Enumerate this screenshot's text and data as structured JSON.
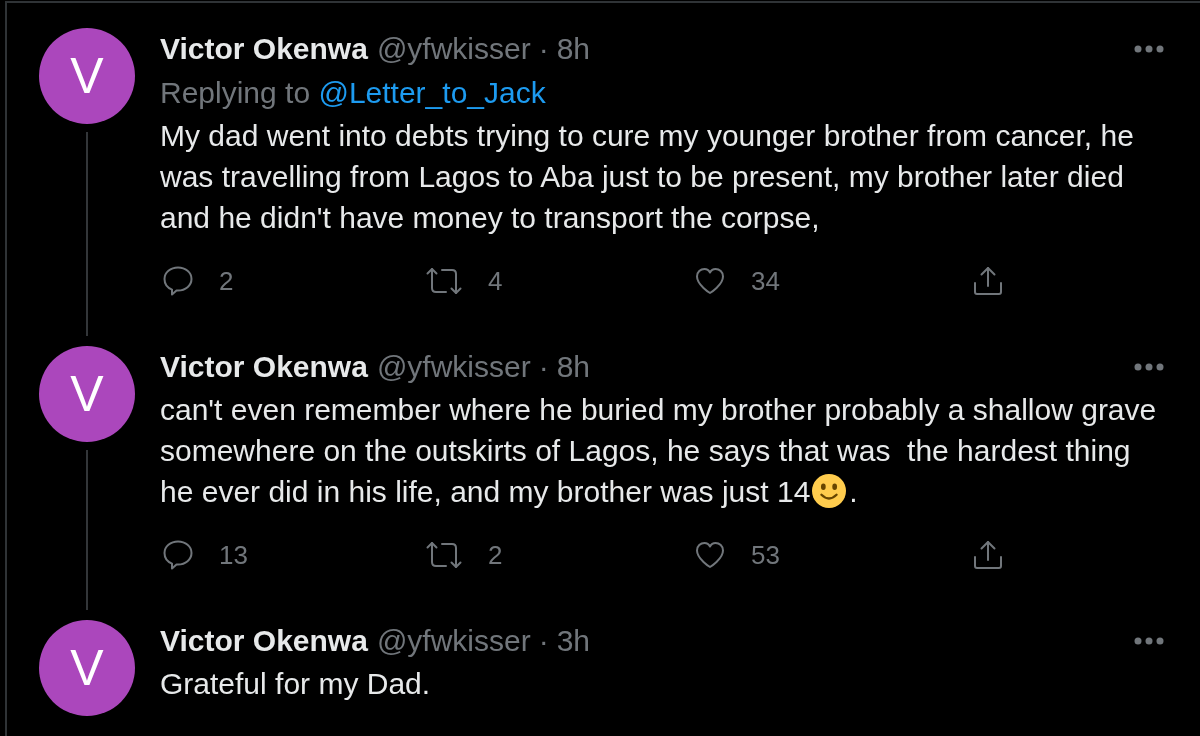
{
  "tweets": [
    {
      "avatar_letter": "V",
      "name": "Victor Okenwa",
      "handle": "@yfwkisser",
      "dot": "·",
      "time": "8h",
      "replying_to": {
        "label": "Replying to",
        "mention": "@Letter_to_Jack"
      },
      "body": [
        {
          "kind": "text",
          "text": "My dad went into debts trying to cure my younger brother from cancer, he was travelling from Lagos to Aba just to be present, my brother later died and he didn't have money to transport the corpse,"
        }
      ],
      "actions": [
        {
          "kind": "reply",
          "count": "2"
        },
        {
          "kind": "retweet",
          "count": "4"
        },
        {
          "kind": "like",
          "count": "34"
        },
        {
          "kind": "share"
        }
      ]
    },
    {
      "avatar_letter": "V",
      "name": "Victor Okenwa",
      "handle": "@yfwkisser",
      "dot": "·",
      "time": "8h",
      "body": [
        {
          "kind": "text",
          "text": "can't even remember where he buried my brother probably a shallow grave somewhere on the outskirts of Lagos, he says that was  the hardest thing he ever did in his life, and my brother was just 14"
        },
        {
          "kind": "emoji"
        },
        {
          "kind": "text",
          "text": "."
        }
      ],
      "actions": [
        {
          "kind": "reply",
          "count": "13"
        },
        {
          "kind": "retweet",
          "count": "2"
        },
        {
          "kind": "like",
          "count": "53"
        },
        {
          "kind": "share"
        }
      ]
    },
    {
      "avatar_letter": "V",
      "name": "Victor Okenwa",
      "handle": "@yfwkisser",
      "dot": "·",
      "time": "3h",
      "body": [
        {
          "kind": "text",
          "text": "Grateful for my Dad."
        }
      ]
    }
  ]
}
